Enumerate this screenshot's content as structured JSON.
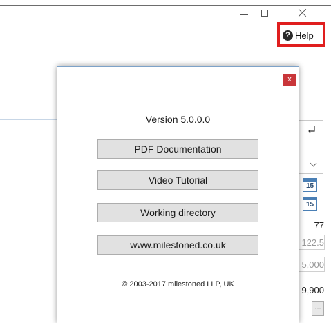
{
  "help": {
    "label": "Help",
    "icon": "question-circle-icon"
  },
  "dialog": {
    "close_label": "x",
    "version": "Version 5.0.0.0",
    "buttons": [
      {
        "label": "PDF Documentation"
      },
      {
        "label": "Video Tutorial"
      },
      {
        "label": "Working directory"
      },
      {
        "label": "www.milestoned.co.uk"
      }
    ],
    "copyright": "© 2003-2017 milestoned LLP, UK"
  },
  "background": {
    "calendar_day_1": "15",
    "calendar_day_2": "15",
    "value_1": "77",
    "value_2": "122.5",
    "value_3": "5,000",
    "value_4": "9,900",
    "ellipsis_label": "..."
  },
  "colors": {
    "highlight": "#e01e1e",
    "dialog_close": "#c9363a",
    "button_face": "#e1e1e1"
  }
}
